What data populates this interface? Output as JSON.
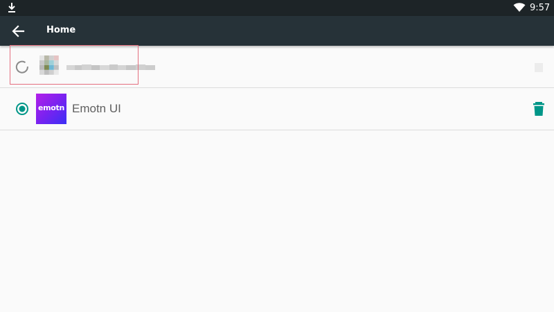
{
  "status_bar": {
    "time": "9:57",
    "icons": [
      "download-icon",
      "wifi-icon"
    ]
  },
  "app_bar": {
    "title": "Home",
    "back_icon": "arrow-back-icon"
  },
  "launchers": [
    {
      "label": "",
      "selected": false,
      "state": "loading",
      "blurred": true
    },
    {
      "label": "Emotn UI",
      "logo_text": "emotn",
      "selected": true,
      "state": "installed"
    }
  ],
  "colors": {
    "status_bar_bg": "#1d2427",
    "app_bar_bg": "#263238",
    "accent": "#009688",
    "background": "#fafafa",
    "highlight_border": "#e46e7e"
  }
}
